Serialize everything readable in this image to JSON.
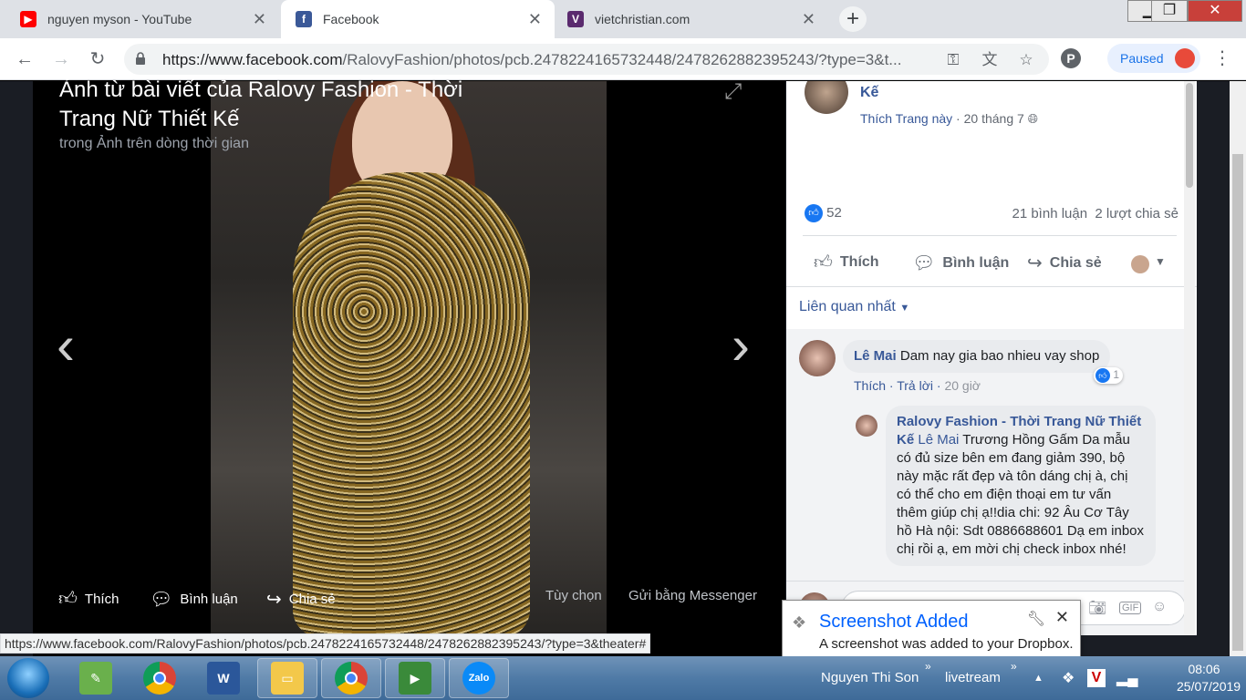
{
  "browser": {
    "tabs": [
      {
        "label": "nguyen myson - YouTube",
        "icon": "youtube-icon",
        "active": false
      },
      {
        "label": "Facebook",
        "icon": "facebook-icon",
        "active": true
      },
      {
        "label": "vietchristian.com",
        "icon": "vietchristian-icon",
        "active": false
      }
    ],
    "newtab_label": "+",
    "url_host": "https://www.facebook.com",
    "url_path": "/RalovyFashion/photos/pcb.2478224165732448/2478262882395243/?type=3&t...",
    "profile_label": "Paused",
    "status_url": "https://www.facebook.com/RalovyFashion/photos/pcb.2478224165732448/2478262882395243/?type=3&theater#"
  },
  "photo": {
    "title": "Ảnh từ bài viết của Ralovy Fashion - Thời Trang Nữ Thiết Kế",
    "subtitle": "trong Ảnh trên dòng thời gian",
    "actions": {
      "like": "Thích",
      "comment": "Bình luận",
      "share": "Chia sẻ",
      "options": "Tùy chọn",
      "messenger": "Gửi bằng Messenger"
    }
  },
  "post": {
    "page_name": "Kế",
    "like_page": "Thích Trang này",
    "date": "20 tháng 7",
    "reaction_count": "52",
    "comment_count": "21 bình luận",
    "share_count": "2 lượt chia sẻ",
    "actions": {
      "like": "Thích",
      "comment": "Bình luận",
      "share": "Chia sẻ"
    },
    "sort_label": "Liên quan nhất"
  },
  "comments": [
    {
      "author": "Lê Mai",
      "text": "Dam nay gia bao nhieu vay shop",
      "like_action": "Thích",
      "reply_action": "Trả lời",
      "time": "20 giờ",
      "likes": "1"
    }
  ],
  "reply": {
    "author": "Ralovy Fashion - Thời Trang Nữ Thiết Kế",
    "tag": "Lê Mai",
    "text": "Trương Hồng Gấm Da mẫu có đủ size bên em đang giảm 390, bộ này mặc rất đẹp và tôn dáng chị à, chị có thể cho em điện thoại em tư vấn thêm giúp chị ạ!!dia chi: 92 Âu Cơ Tây hồ Hà nội: Sdt 0886688601 Dạ em inbox chị rồi ạ, em mời chị check inbox nhé!"
  },
  "toast": {
    "title": "Screenshot Added",
    "body": "A screenshot was added to your Dropbox."
  },
  "taskbar": {
    "tray_user": "Nguyen Thi Son",
    "tray_item": "livetream",
    "time": "08:06",
    "date": "25/07/2019",
    "zalo_label": "Zalo"
  },
  "colors": {
    "facebook_blue": "#385898",
    "like_blue": "#1877f2",
    "dropbox_blue": "#0061fe"
  }
}
